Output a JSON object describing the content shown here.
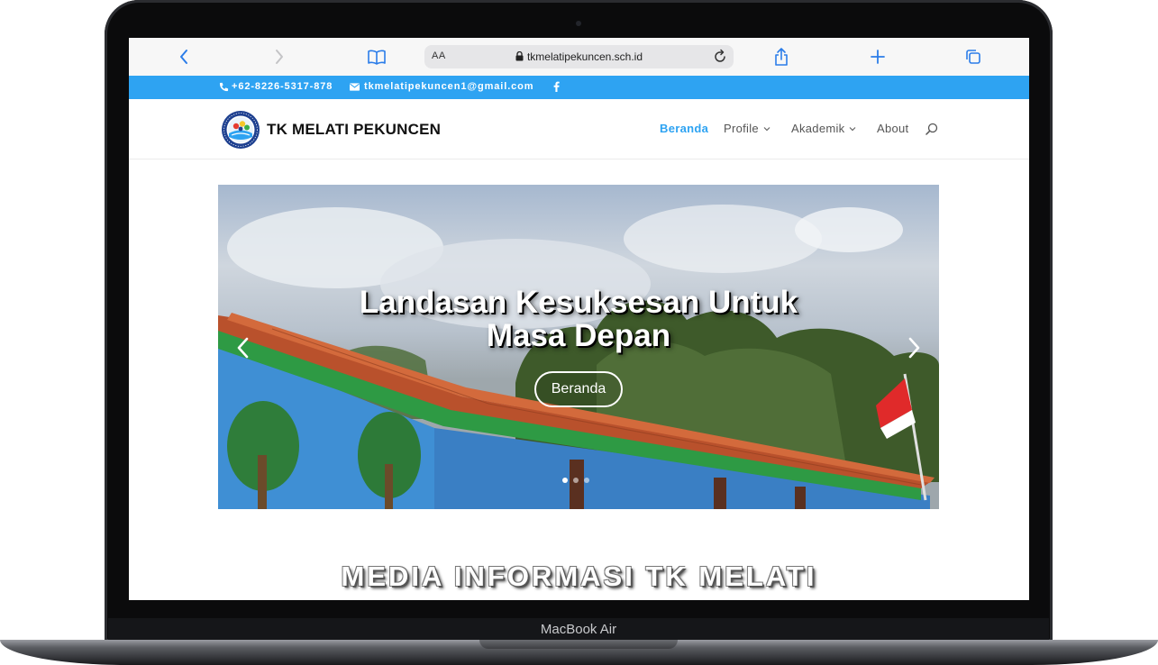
{
  "device": {
    "label": "MacBook Air"
  },
  "browser": {
    "aa_label": "AA",
    "url": "tkmelatipekuncen.sch.id",
    "icons": [
      "chevron-left-icon",
      "chevron-right-icon",
      "book-icon",
      "lock-icon",
      "reload-icon",
      "share-icon",
      "plus-icon",
      "tabs-icon"
    ],
    "accent": "#2b7de9"
  },
  "topbar": {
    "phone": "+62-8226-5317-878",
    "email": "tkmelatipekuncen1@gmail.com",
    "color": "#2ea3f2"
  },
  "header": {
    "site_name": "TK MELATI PEKUNCEN",
    "nav": [
      {
        "label": "Beranda",
        "active": true,
        "dropdown": false
      },
      {
        "label": "Profile",
        "active": false,
        "dropdown": true
      },
      {
        "label": "Akademik",
        "active": false,
        "dropdown": true
      },
      {
        "label": "About",
        "active": false,
        "dropdown": false
      }
    ]
  },
  "slider": {
    "title_line1": "Landasan Kesuksesan Untuk",
    "title_line2": "Masa Depan",
    "button_label": "Beranda",
    "slide_count": 3,
    "active_slide": 1
  },
  "section": {
    "title": "MEDIA INFORMASI TK MELATI"
  }
}
